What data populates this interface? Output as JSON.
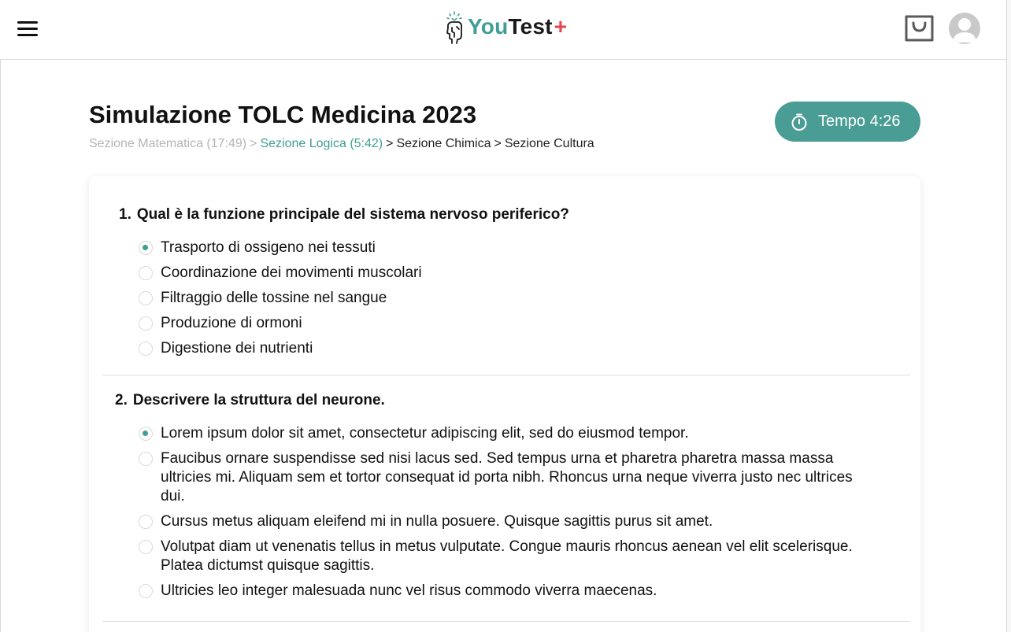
{
  "header": {
    "logo_you": "You",
    "logo_test": "Test",
    "logo_plus": "+"
  },
  "page": {
    "title": "Simulazione TOLC Medicina 2023"
  },
  "breadcrumb": [
    {
      "label": "Sezione Matematica (17:49)",
      "state": "done"
    },
    {
      "label": "Sezione Logica (5:42)",
      "state": "active"
    },
    {
      "label": "Sezione Chimica",
      "state": "upcoming"
    },
    {
      "label": "Sezione Cultura",
      "state": "upcoming"
    }
  ],
  "breadcrumb_separator": ">",
  "timer": {
    "label": "Tempo 4:26"
  },
  "colors": {
    "accent": "#4a9d94",
    "logo_plus": "#e2464b"
  },
  "questions": [
    {
      "number": "1.",
      "text": "Qual è la funzione principale del sistema nervoso periferico?",
      "options": [
        {
          "text": "Trasporto di ossigeno nei tessuti",
          "selected": true
        },
        {
          "text": "Coordinazione dei movimenti muscolari",
          "selected": false
        },
        {
          "text": "Filtraggio delle tossine nel sangue",
          "selected": false
        },
        {
          "text": "Produzione di ormoni",
          "selected": false
        },
        {
          "text": "Digestione dei nutrienti",
          "selected": false
        }
      ]
    },
    {
      "number": "2.",
      "text": "Descrivere la struttura del neurone.",
      "options": [
        {
          "text": "Lorem ipsum dolor sit amet, consectetur adipiscing elit, sed do eiusmod tempor.",
          "selected": true
        },
        {
          "text": "Faucibus ornare suspendisse sed nisi lacus sed. Sed tempus urna et pharetra pharetra massa massa ultricies mi. Aliquam sem et tortor consequat id porta nibh. Rhoncus urna neque viverra justo nec ultrices dui.",
          "selected": false
        },
        {
          "text": "Cursus metus aliquam eleifend mi in nulla posuere. Quisque sagittis purus sit amet.",
          "selected": false
        },
        {
          "text": "Volutpat diam ut venenatis tellus in metus vulputate. Congue mauris rhoncus aenean vel elit scelerisque. Platea dictumst quisque sagittis.",
          "selected": false
        },
        {
          "text": "Ultricies leo integer malesuada nunc vel risus commodo viverra maecenas.",
          "selected": false
        }
      ]
    }
  ]
}
